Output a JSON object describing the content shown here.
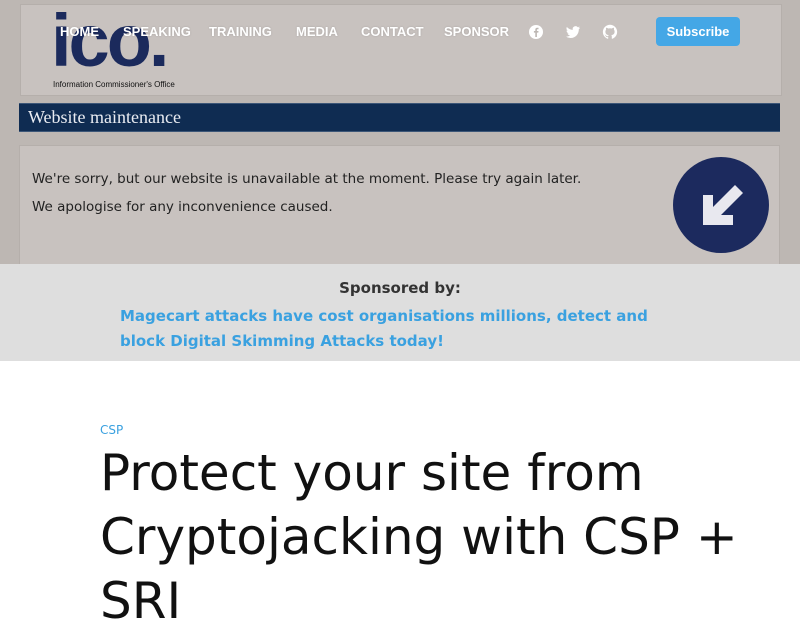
{
  "hero": {
    "logo_word": "ico.",
    "logo_subtitle": "Information Commissioner's Office",
    "maintenance_title": "Website maintenance",
    "message_line_1": "We're sorry, but our website is unavailable at the moment. Please try again later.",
    "message_line_2": "We apologise for any inconvenience caused.",
    "arrow_icon": "arrow-down-left-icon"
  },
  "nav": {
    "items": [
      {
        "label": "HOME"
      },
      {
        "label": "SPEAKING"
      },
      {
        "label": "TRAINING"
      },
      {
        "label": "MEDIA"
      },
      {
        "label": "CONTACT"
      },
      {
        "label": "SPONSOR"
      }
    ],
    "social_icons": [
      "facebook-icon",
      "twitter-icon",
      "github-icon"
    ],
    "subscribe_label": "Subscribe"
  },
  "sponsor": {
    "label": "Sponsored by:",
    "link_text": "Magecart attacks have cost organisations millions, detect and block Digital Skimming Attacks today!"
  },
  "article": {
    "tag": "CSP",
    "title": "Protect your site from Cryptojacking with CSP + SRI"
  },
  "colors": {
    "accent": "#44a7e6",
    "link": "#3aa1e0",
    "sponsor_bg": "#dedede",
    "maintenance_bar": "#0f2c52"
  }
}
